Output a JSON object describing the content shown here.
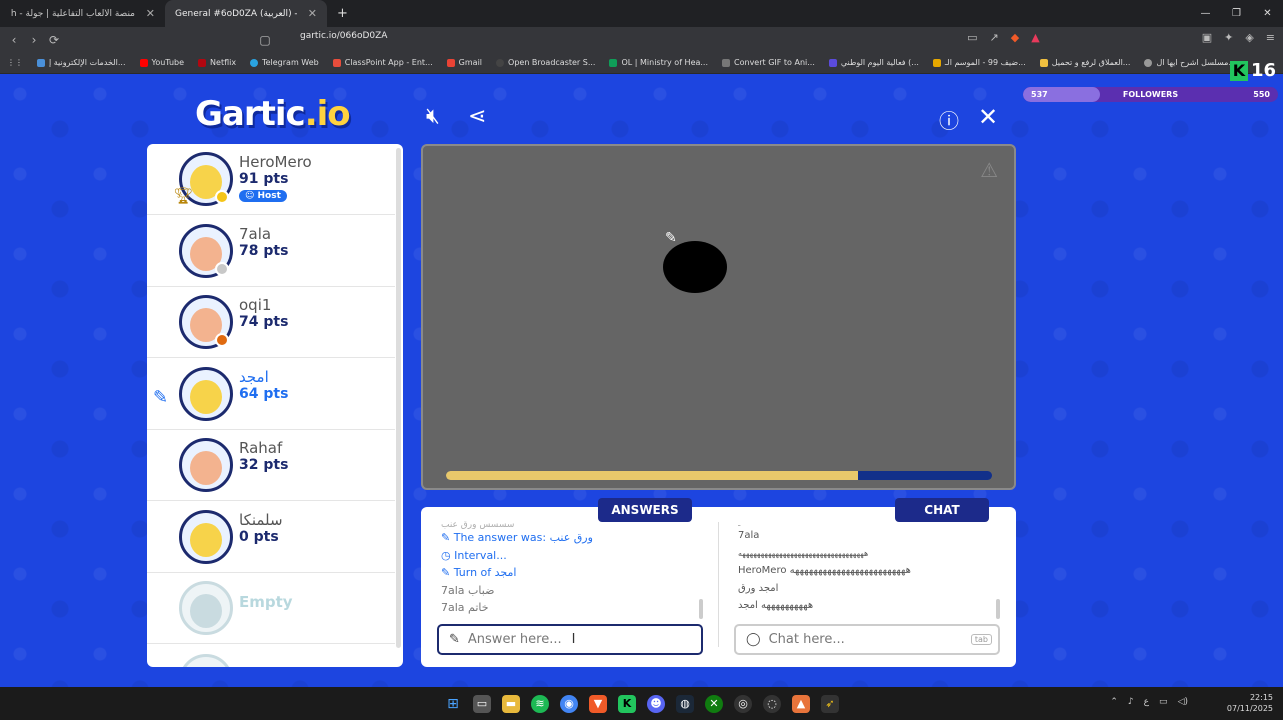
{
  "browser": {
    "tabs": [
      {
        "title": "منصة الألعاب التفاعلية | جولة - Jawlah",
        "active": false
      },
      {
        "title": "General #6oD0ZA (العربية) - Gartic",
        "active": true
      }
    ],
    "new_tab": "+",
    "url": "gartic.io/066oD0ZA",
    "bookmarks": [
      "الخدمات الإلكترونية إ...",
      "YouTube",
      "Netflix",
      "Telegram Web",
      "ClassPoint App - Ent...",
      "Gmail",
      "Open Broadcaster S...",
      "OL | Ministry of Hea...",
      "Convert GIF to Ani...",
      "فعالية اليوم الوطني (...",
      "ضيف 99 - الموسم الـ...",
      "العملاق لرفع و تحميل...",
      "مسلسل اشرح ايها ال..."
    ]
  },
  "game": {
    "logo_main": "Gartic",
    "logo_suffix": ".io",
    "followers": {
      "left": "537",
      "label": "FOLLOWERS",
      "right": "550",
      "progress": 0.3
    },
    "kick_count": "16",
    "players": [
      {
        "name": "HeroMero",
        "pts": "91 pts",
        "host": "Host",
        "dot": "#f5c518",
        "face": "#f7d34a",
        "drawing": false
      },
      {
        "name": "7ala",
        "pts": "78 pts",
        "dot": "#c8c8c8",
        "face": "#f3b38f",
        "drawing": false
      },
      {
        "name": "oqi1",
        "pts": "74 pts",
        "dot": "#e06a10",
        "face": "#f3b38f",
        "drawing": false
      },
      {
        "name": "امجد",
        "pts": "64 pts",
        "dot": "",
        "face": "#f7d34a",
        "drawing": true
      },
      {
        "name": "Rahaf",
        "pts": "32 pts",
        "dot": "",
        "face": "#f3b38f",
        "drawing": false
      },
      {
        "name": "سلمنكا",
        "pts": "0 pts",
        "dot": "",
        "face": "#f7d34a",
        "drawing": false
      },
      {
        "name": "Empty",
        "pts": "",
        "dot": "",
        "face": "#c9dbe0",
        "drawing": false
      }
    ],
    "timer_progress": 0.755,
    "answers_label": "ANSWERS",
    "chat_label": "CHAT",
    "answers_log": [
      {
        "text": "سسسس ورق عنب",
        "style": "g"
      },
      {
        "text": "The answer was: ورق عنب",
        "style": "b"
      },
      {
        "text": "Interval...",
        "style": "b"
      },
      {
        "text": "Turn of امجد",
        "style": "b"
      },
      {
        "text": "7ala ضباب",
        "style": "g"
      },
      {
        "text": "7ala خاتم",
        "style": "g"
      }
    ],
    "chat_log": [
      "ـ",
      "7ala",
      "ههههههههههههههههههههههههههههههههههه",
      "HeroMero هههههههههههههههههههههههههه",
      "امجد ورق",
      "ههههههههههه امجد"
    ],
    "answer_placeholder": "Answer here...",
    "chat_placeholder": "Chat here...",
    "tab_key": "tab"
  },
  "taskbar": {
    "time": "22:15",
    "date": "07/11/2025"
  }
}
